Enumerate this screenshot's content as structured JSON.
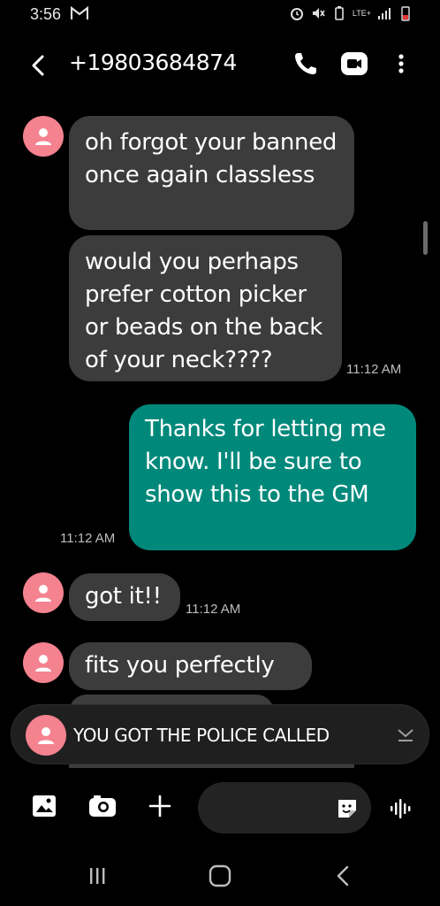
{
  "status_bar": {
    "time": "3:56",
    "network": "LTE+"
  },
  "header": {
    "contact": "+19803684874"
  },
  "messages": [
    {
      "dir": "in",
      "text": "oh forgot your banned once again classless",
      "time": ""
    },
    {
      "dir": "in",
      "text": "would you perhaps prefer cotton picker or beads on the back of your neck????",
      "time": "11:12 AM"
    },
    {
      "dir": "out",
      "text": "Thanks for letting me know. I'll be sure to show this to the GM",
      "time": "11:12 AM"
    },
    {
      "dir": "in",
      "text": "got it!!",
      "time": "11:12 AM"
    },
    {
      "dir": "in",
      "text": "fits you perfectly",
      "time": ""
    }
  ],
  "notification": {
    "text": "YOU GOT THE POLICE CALLED"
  },
  "composer": {
    "placeholder": ""
  },
  "colors": {
    "background": "#000000",
    "incoming_bubble": "#3c3c3c",
    "outgoing_bubble": "#00897b",
    "avatar": "#f4828f"
  },
  "icons": [
    "back-arrow-icon",
    "phone-icon",
    "video-icon",
    "more-vert-icon",
    "person-icon",
    "image-icon",
    "camera-icon",
    "plus-icon",
    "sticker-icon",
    "voice-wave-icon",
    "recents-icon",
    "home-icon",
    "nav-back-icon",
    "chevron-down-icon"
  ]
}
